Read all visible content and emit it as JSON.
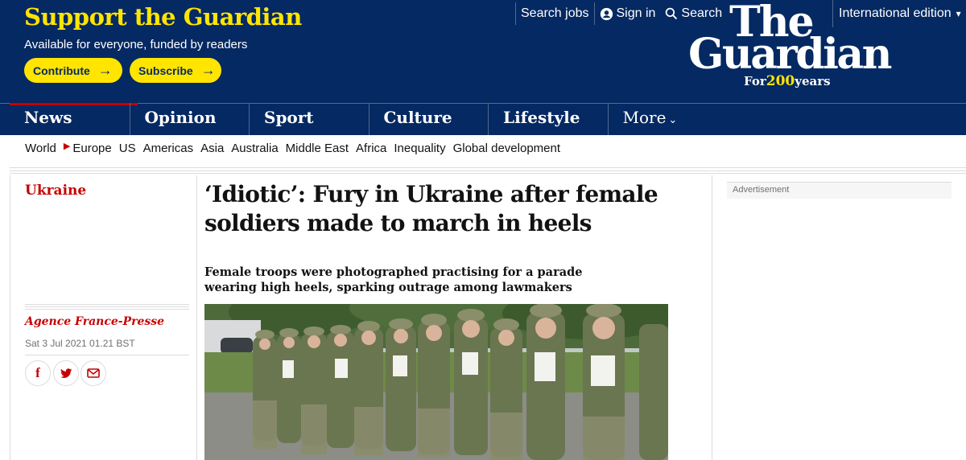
{
  "support": {
    "title": "Support the Guardian",
    "subtitle": "Available for everyone, funded by readers",
    "contribute_label": "Contribute",
    "subscribe_label": "Subscribe"
  },
  "top_links": {
    "search_jobs": "Search jobs",
    "sign_in": "Sign in",
    "search": "Search",
    "edition": "International edition"
  },
  "logo": {
    "the": "The",
    "guardian": "Guardian",
    "for": "For",
    "years_number": "200",
    "years": "years"
  },
  "pillars": [
    "News",
    "Opinion",
    "Sport",
    "Culture",
    "Lifestyle"
  ],
  "more_label": "More",
  "subnav": [
    "World",
    "Europe",
    "US",
    "Americas",
    "Asia",
    "Australia",
    "Middle East",
    "Africa",
    "Inequality",
    "Global development"
  ],
  "article": {
    "section": "Ukraine",
    "headline": "‘Idiotic’: Fury in Ukraine after female soldiers made to march in heels",
    "standfirst": "Female troops were photographed practising for a parade wearing high heels, sparking outrage among lawmakers",
    "byline": "Agence France-Presse",
    "date": "Sat 3 Jul 2021 01.21 BST"
  },
  "advertisement_label": "Advertisement",
  "colors": {
    "brand_blue": "#052962",
    "brand_yellow": "#ffe500",
    "news_red": "#c70000"
  }
}
